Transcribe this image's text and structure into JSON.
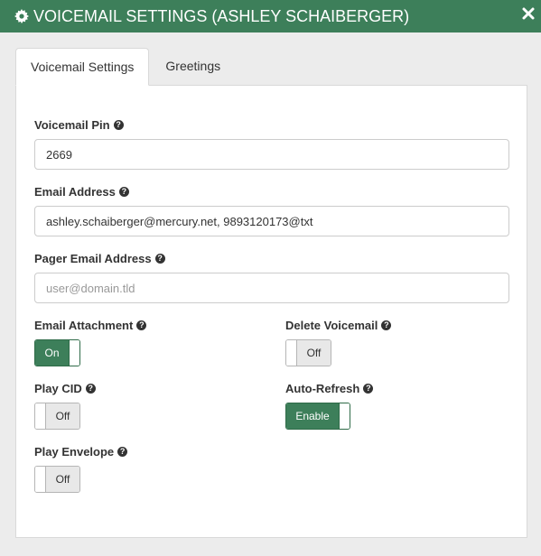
{
  "header": {
    "title": "VOICEMAIL SETTINGS (ASHLEY SCHAIBERGER)",
    "icon": "gear-icon",
    "close_icon": "close-icon"
  },
  "tabs": [
    {
      "label": "Voicemail Settings",
      "active": true
    },
    {
      "label": "Greetings",
      "active": false
    }
  ],
  "form": {
    "voicemail_pin": {
      "label": "Voicemail Pin",
      "value": "2669"
    },
    "email_address": {
      "label": "Email Address",
      "value": "ashley.schaiberger@mercury.net, 9893120173@txt"
    },
    "pager_email": {
      "label": "Pager Email Address",
      "value": "",
      "placeholder": "user@domain.tld"
    },
    "email_attachment": {
      "label": "Email Attachment",
      "state": "On"
    },
    "delete_voicemail": {
      "label": "Delete Voicemail",
      "state": "Off"
    },
    "play_cid": {
      "label": "Play CID",
      "state": "Off"
    },
    "auto_refresh": {
      "label": "Auto-Refresh",
      "state": "Enable"
    },
    "play_envelope": {
      "label": "Play Envelope",
      "state": "Off"
    }
  },
  "help_glyph": "?",
  "colors": {
    "header_bg": "#3d7f5a",
    "toggle_on": "#3d7f5a",
    "toggle_off": "#e8e8e8"
  }
}
